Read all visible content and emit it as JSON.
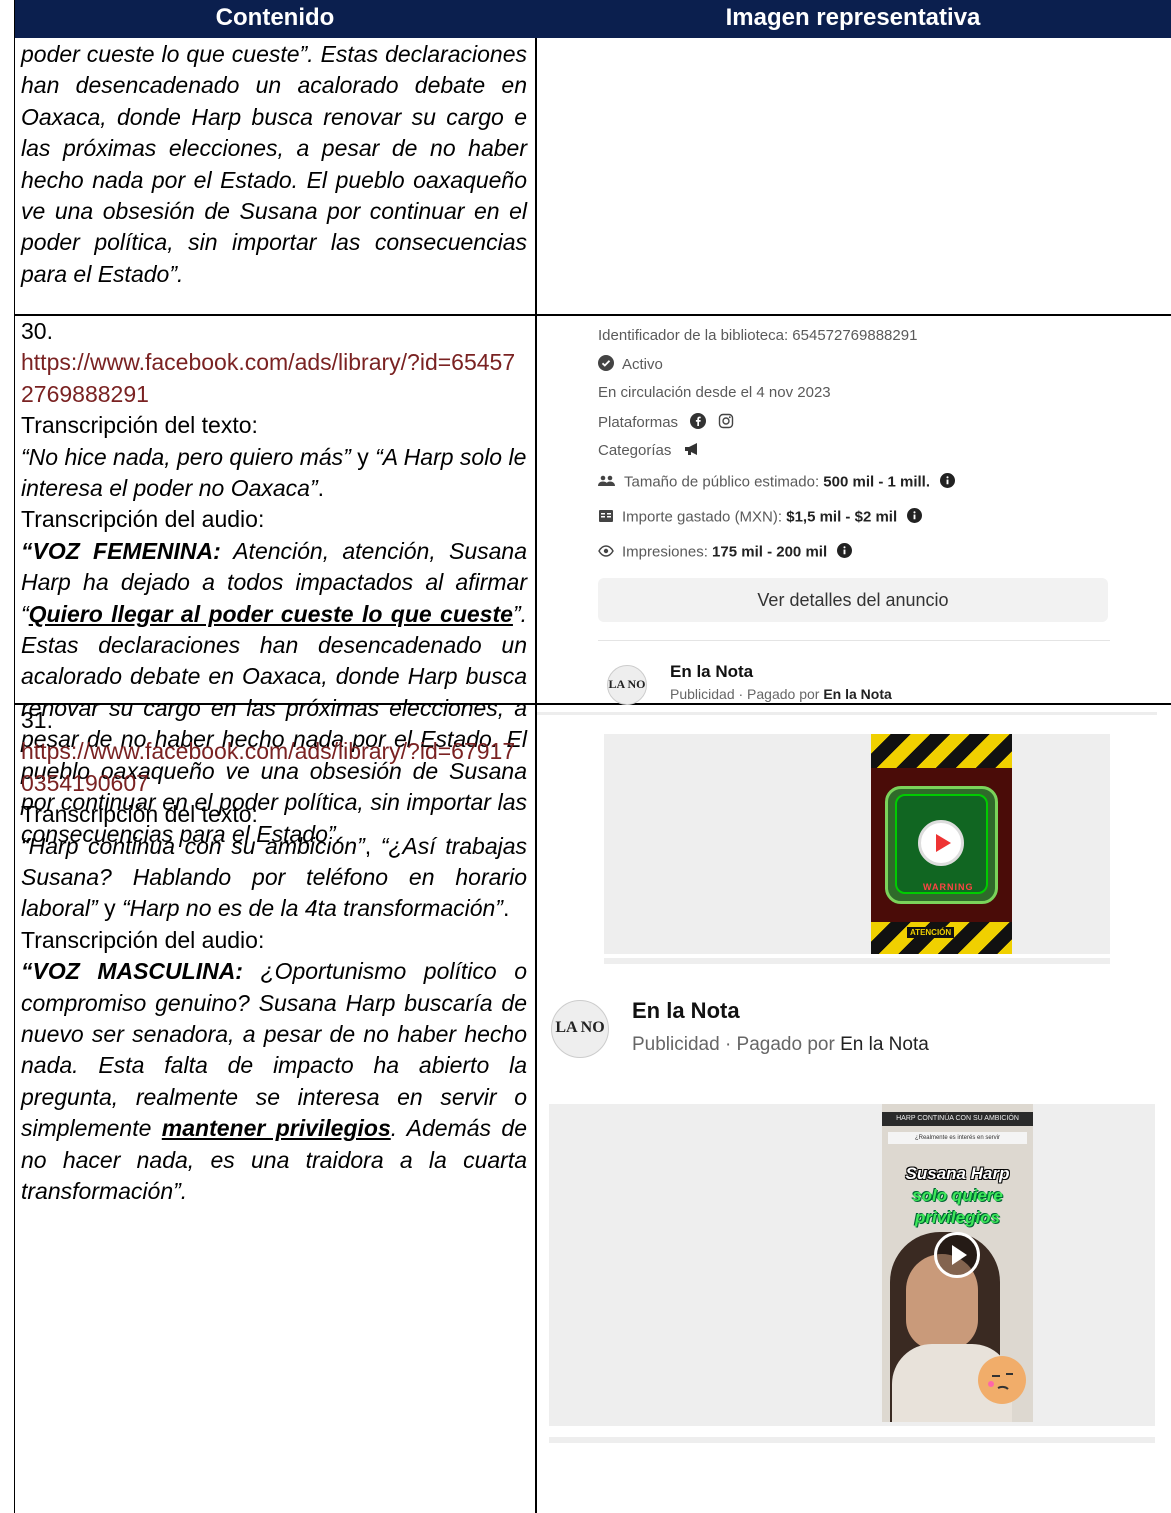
{
  "header": {
    "col1": "Contenido",
    "col2": "Imagen representativa"
  },
  "row_prev": {
    "text": "poder cueste lo que cueste”. Estas declaraciones han desencadenado un acalorado debate en Oaxaca, donde Harp busca renovar su cargo e las próximas elecciones, a pesar de no haber hecho nada por el Estado. El pueblo oaxaqueño ve una obsesión de Susana por continuar en el poder política, sin importar las consecuencias para el Estado”."
  },
  "row30": {
    "number": "30.",
    "link": "https://www.facebook.com/ads/library/?id=654572769888291",
    "text_heading": "Transcripción del texto:",
    "text_q1": "“No hice nada, pero quiero más”",
    "text_y": " y ",
    "text_q2": "“A Harp solo le interesa el poder no Oaxaca”",
    "text_end": ".",
    "audio_heading": "Transcripción del audio:",
    "speaker": "“VOZ FEMENINA:",
    "audio_a": " Atención, atención, Susana Harp ha dejado a todos impactados al afirmar “",
    "audio_quote": "Quiero llegar al poder cueste lo que cueste",
    "audio_b": "”. Estas declaraciones han desencadenado un acalorado debate en Oaxaca, donde Harp busca renovar su cargo en las próximas elecciones, a pesar de no haber hecho nada por el Estado. El pueblo oaxaqueño ve una obsesión de Susana por continuar en el poder política, sin importar las consecuencias para el Estado”.",
    "ad": {
      "library_id": "Identificador de la biblioteca: 654572769888291",
      "status": "Activo",
      "since": "En circulación desde el 4 nov 2023",
      "platforms": "Plataformas",
      "categories": "Categorías",
      "audience_label": "Tamaño de público estimado: ",
      "audience_value": "500 mil - 1 mill.",
      "spent_label": "Importe gastado (MXN): ",
      "spent_value": "$1,5 mil - $2 mil",
      "impressions_label": "Impresiones: ",
      "impressions_value": "175 mil - 200 mil",
      "details_button": "Ver detalles del anuncio",
      "page_name": "En la Nota",
      "sponsored": "Publicidad · Pagado por ",
      "payer": "En la Nota",
      "video_bottom_label": "ATENCIÓN",
      "video_mid_label": "WARNING"
    }
  },
  "row31": {
    "number": "31.",
    "link": "https://www.facebook.com/ads/library/?id=679170354190607",
    "text_heading": "Transcripción del texto:",
    "text_q1": "“Harp continua con su ambición”",
    "text_c": ", ",
    "text_q2": "“¿Así trabajas Susana? Hablando por teléfono en horario laboral”",
    "text_y": " y ",
    "text_q3": "“Harp no es de la 4ta transformación”",
    "text_end": ".",
    "audio_heading": "Transcripción del audio:",
    "speaker": "“VOZ MASCULINA:",
    "audio_a": " ¿Oportunismo político o compromiso genuino? Susana Harp buscaría de nuevo ser senadora, a pesar de no haber hecho nada. Esta falta de impacto ha abierto la pregunta, realmente se interesa en servir o simplemente ",
    "audio_quote": "mantener privilegios",
    "audio_b": ". Además de no hacer nada, es una traidora a la cuarta transformación”.",
    "ad": {
      "page_name": "En la Nota",
      "sponsored": "Publicidad · Pagado por ",
      "payer": "En la Nota",
      "thumb_top": "HARP CONTINÚA CON SU AMBICIÓN",
      "thumb_sub": "¿Realmente es interés en servir",
      "thumb_title1": "Susana Harp",
      "thumb_title2": "solo quiere",
      "thumb_title3": "privilegios"
    }
  },
  "logo_text": "LA NO"
}
